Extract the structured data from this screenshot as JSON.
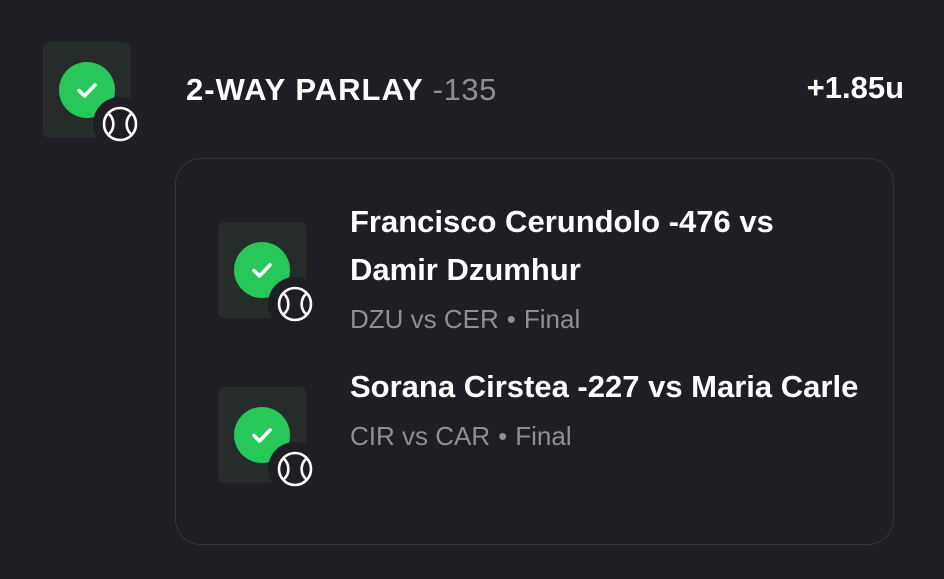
{
  "parlay": {
    "title": "2-WAY PARLAY",
    "odds": "-135",
    "result": "+1.85u",
    "status_icon": "check-icon",
    "sport_icon": "tennis-ball-icon"
  },
  "legs": [
    {
      "title": "Francisco Cerundolo -476 vs Damir Dzumhur",
      "matchup": "DZU vs CER",
      "separator": "•",
      "status": "Final",
      "status_icon": "check-icon",
      "sport_icon": "tennis-ball-icon"
    },
    {
      "title": "Sorana Cirstea -227 vs Maria Carle",
      "matchup": "CIR vs CAR",
      "separator": "•",
      "status": "Final",
      "status_icon": "check-icon",
      "sport_icon": "tennis-ball-icon"
    }
  ],
  "colors": {
    "background": "#1f1e24",
    "win_green": "#27c75a",
    "muted_text": "#8f8f95",
    "card_border": "#35343a"
  }
}
